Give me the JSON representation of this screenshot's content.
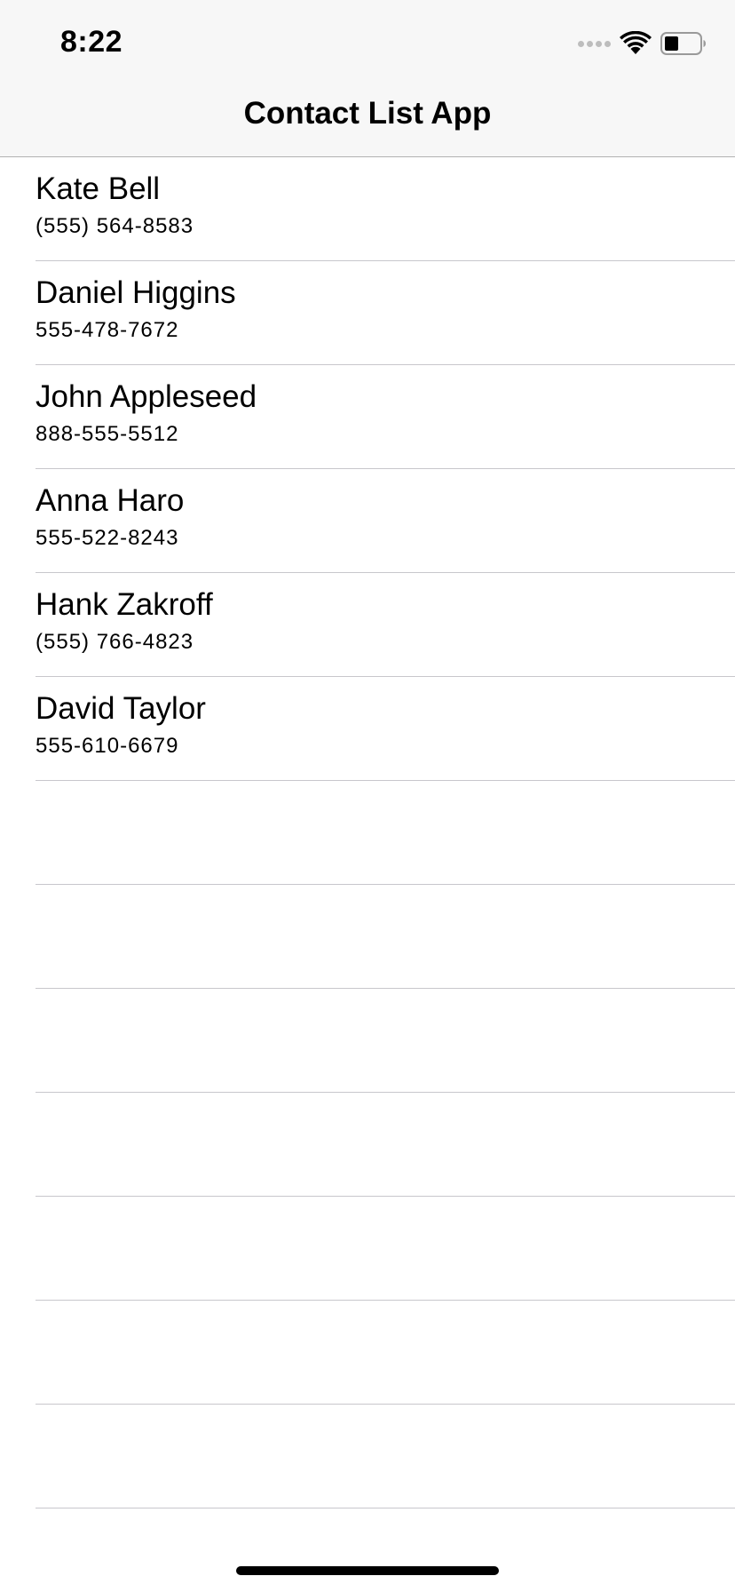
{
  "status_bar": {
    "time": "8:22",
    "icons": [
      "signal-icon",
      "wifi-icon",
      "battery-icon"
    ]
  },
  "nav": {
    "title": "Contact List App"
  },
  "contacts": [
    {
      "name": "Kate Bell",
      "phone": "(555) 564-8583"
    },
    {
      "name": "Daniel Higgins",
      "phone": "555-478-7672"
    },
    {
      "name": "John Appleseed",
      "phone": "888-555-5512"
    },
    {
      "name": "Anna Haro",
      "phone": "555-522-8243"
    },
    {
      "name": "Hank Zakroff",
      "phone": "(555) 766-4823"
    },
    {
      "name": "David Taylor",
      "phone": "555-610-6679"
    }
  ],
  "colors": {
    "header_background": "#f7f7f7",
    "separator": "#c8c7cc",
    "text": "#000000"
  }
}
